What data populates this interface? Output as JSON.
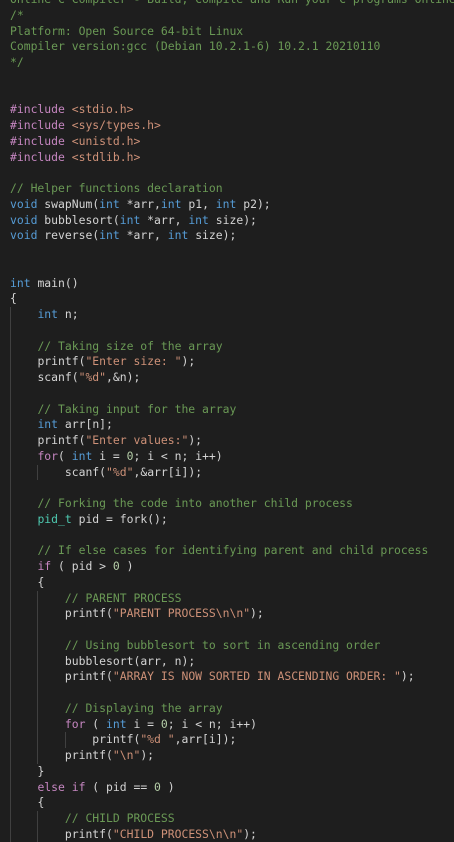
{
  "editor": {
    "background": "#1e1e1e",
    "colors": {
      "comment": "#6a9955",
      "keyword": "#c586c0",
      "string": "#ce9178",
      "type": "#569cd6",
      "variable": "#9cdcfe",
      "function": "#dcdcaa",
      "number": "#b5cea8",
      "type_name": "#4ec9b0",
      "plain": "#d4d4d4"
    },
    "lines": [
      {
        "indent": 0,
        "tokens": [
          {
            "t": "comment",
            "v": "Online C Compiler - Build, Compile and Run your C programs Online in your favorite browser"
          }
        ]
      },
      {
        "indent": 0,
        "tokens": [
          {
            "t": "comment",
            "v": "/*"
          }
        ]
      },
      {
        "indent": 0,
        "tokens": [
          {
            "t": "comment",
            "v": "Platform: Open Source 64-bit Linux"
          }
        ]
      },
      {
        "indent": 0,
        "tokens": [
          {
            "t": "comment",
            "v": "Compiler version:gcc (Debian 10.2.1-6) 10.2.1 20210110"
          }
        ]
      },
      {
        "indent": 0,
        "tokens": [
          {
            "t": "comment",
            "v": "*/"
          }
        ]
      },
      {
        "indent": 0,
        "tokens": []
      },
      {
        "indent": 0,
        "tokens": []
      },
      {
        "indent": 0,
        "tokens": [
          {
            "t": "keyword",
            "v": "#include"
          },
          {
            "t": "plain",
            "v": " "
          },
          {
            "t": "string",
            "v": "<stdio.h>"
          }
        ]
      },
      {
        "indent": 0,
        "tokens": [
          {
            "t": "keyword",
            "v": "#include"
          },
          {
            "t": "plain",
            "v": " "
          },
          {
            "t": "string",
            "v": "<sys/types.h>"
          }
        ]
      },
      {
        "indent": 0,
        "tokens": [
          {
            "t": "keyword",
            "v": "#include"
          },
          {
            "t": "plain",
            "v": " "
          },
          {
            "t": "string",
            "v": "<unistd.h>"
          }
        ]
      },
      {
        "indent": 0,
        "tokens": [
          {
            "t": "keyword",
            "v": "#include"
          },
          {
            "t": "plain",
            "v": " "
          },
          {
            "t": "string",
            "v": "<stdlib.h>"
          }
        ]
      },
      {
        "indent": 0,
        "tokens": []
      },
      {
        "indent": 0,
        "tokens": [
          {
            "t": "comment",
            "v": "// Helper functions declaration"
          }
        ]
      },
      {
        "indent": 0,
        "tokens": [
          {
            "t": "type",
            "v": "void"
          },
          {
            "t": "plain",
            "v": " "
          },
          {
            "t": "function",
            "v": "swapNum"
          },
          {
            "t": "plain",
            "v": "("
          },
          {
            "t": "type",
            "v": "int"
          },
          {
            "t": "plain",
            "v": " *"
          },
          {
            "t": "variable",
            "v": "arr"
          },
          {
            "t": "plain",
            "v": ","
          },
          {
            "t": "type",
            "v": "int"
          },
          {
            "t": "plain",
            "v": " "
          },
          {
            "t": "variable",
            "v": "p1"
          },
          {
            "t": "plain",
            "v": ", "
          },
          {
            "t": "type",
            "v": "int"
          },
          {
            "t": "plain",
            "v": " "
          },
          {
            "t": "variable",
            "v": "p2"
          },
          {
            "t": "plain",
            "v": ");"
          }
        ]
      },
      {
        "indent": 0,
        "tokens": [
          {
            "t": "type",
            "v": "void"
          },
          {
            "t": "plain",
            "v": " "
          },
          {
            "t": "function",
            "v": "bubblesort"
          },
          {
            "t": "plain",
            "v": "("
          },
          {
            "t": "type",
            "v": "int"
          },
          {
            "t": "plain",
            "v": " *"
          },
          {
            "t": "variable",
            "v": "arr"
          },
          {
            "t": "plain",
            "v": ", "
          },
          {
            "t": "type",
            "v": "int"
          },
          {
            "t": "plain",
            "v": " "
          },
          {
            "t": "variable",
            "v": "size"
          },
          {
            "t": "plain",
            "v": ");"
          }
        ]
      },
      {
        "indent": 0,
        "tokens": [
          {
            "t": "type",
            "v": "void"
          },
          {
            "t": "plain",
            "v": " "
          },
          {
            "t": "function",
            "v": "reverse"
          },
          {
            "t": "plain",
            "v": "("
          },
          {
            "t": "type",
            "v": "int"
          },
          {
            "t": "plain",
            "v": " *"
          },
          {
            "t": "variable",
            "v": "arr"
          },
          {
            "t": "plain",
            "v": ", "
          },
          {
            "t": "type",
            "v": "int"
          },
          {
            "t": "plain",
            "v": " "
          },
          {
            "t": "variable",
            "v": "size"
          },
          {
            "t": "plain",
            "v": ");"
          }
        ]
      },
      {
        "indent": 0,
        "tokens": []
      },
      {
        "indent": 0,
        "tokens": []
      },
      {
        "indent": 0,
        "tokens": [
          {
            "t": "type",
            "v": "int"
          },
          {
            "t": "plain",
            "v": " "
          },
          {
            "t": "function",
            "v": "main"
          },
          {
            "t": "plain",
            "v": "()"
          }
        ]
      },
      {
        "indent": 0,
        "tokens": [
          {
            "t": "plain",
            "v": "{"
          }
        ]
      },
      {
        "indent": 1,
        "tokens": [
          {
            "t": "type",
            "v": "int"
          },
          {
            "t": "plain",
            "v": " "
          },
          {
            "t": "variable",
            "v": "n"
          },
          {
            "t": "plain",
            "v": ";"
          }
        ]
      },
      {
        "indent": 1,
        "tokens": []
      },
      {
        "indent": 1,
        "tokens": [
          {
            "t": "comment",
            "v": "// Taking size of the array"
          }
        ]
      },
      {
        "indent": 1,
        "tokens": [
          {
            "t": "function",
            "v": "printf"
          },
          {
            "t": "plain",
            "v": "("
          },
          {
            "t": "string",
            "v": "\"Enter size: \""
          },
          {
            "t": "plain",
            "v": ");"
          }
        ]
      },
      {
        "indent": 1,
        "tokens": [
          {
            "t": "function",
            "v": "scanf"
          },
          {
            "t": "plain",
            "v": "("
          },
          {
            "t": "string",
            "v": "\"%d\""
          },
          {
            "t": "plain",
            "v": ",&"
          },
          {
            "t": "variable",
            "v": "n"
          },
          {
            "t": "plain",
            "v": ");"
          }
        ]
      },
      {
        "indent": 1,
        "tokens": []
      },
      {
        "indent": 1,
        "tokens": [
          {
            "t": "comment",
            "v": "// Taking input for the array"
          }
        ]
      },
      {
        "indent": 1,
        "tokens": [
          {
            "t": "type",
            "v": "int"
          },
          {
            "t": "plain",
            "v": " "
          },
          {
            "t": "variable",
            "v": "arr"
          },
          {
            "t": "plain",
            "v": "["
          },
          {
            "t": "variable",
            "v": "n"
          },
          {
            "t": "plain",
            "v": "];"
          }
        ]
      },
      {
        "indent": 1,
        "tokens": [
          {
            "t": "function",
            "v": "printf"
          },
          {
            "t": "plain",
            "v": "("
          },
          {
            "t": "string",
            "v": "\"Enter values:\""
          },
          {
            "t": "plain",
            "v": ");"
          }
        ]
      },
      {
        "indent": 1,
        "tokens": [
          {
            "t": "keyword",
            "v": "for"
          },
          {
            "t": "plain",
            "v": "( "
          },
          {
            "t": "type",
            "v": "int"
          },
          {
            "t": "plain",
            "v": " "
          },
          {
            "t": "variable",
            "v": "i"
          },
          {
            "t": "plain",
            "v": " = "
          },
          {
            "t": "num",
            "v": "0"
          },
          {
            "t": "plain",
            "v": "; "
          },
          {
            "t": "variable",
            "v": "i"
          },
          {
            "t": "plain",
            "v": " < "
          },
          {
            "t": "variable",
            "v": "n"
          },
          {
            "t": "plain",
            "v": "; "
          },
          {
            "t": "variable",
            "v": "i"
          },
          {
            "t": "plain",
            "v": "++)"
          }
        ]
      },
      {
        "indent": 2,
        "tokens": [
          {
            "t": "function",
            "v": "scanf"
          },
          {
            "t": "plain",
            "v": "("
          },
          {
            "t": "string",
            "v": "\"%d\""
          },
          {
            "t": "plain",
            "v": ",&"
          },
          {
            "t": "variable",
            "v": "arr"
          },
          {
            "t": "plain",
            "v": "["
          },
          {
            "t": "variable",
            "v": "i"
          },
          {
            "t": "plain",
            "v": "]);"
          }
        ]
      },
      {
        "indent": 1,
        "tokens": []
      },
      {
        "indent": 1,
        "tokens": [
          {
            "t": "comment",
            "v": "// Forking the code into another child process"
          }
        ]
      },
      {
        "indent": 1,
        "tokens": [
          {
            "t": "type2",
            "v": "pid_t"
          },
          {
            "t": "plain",
            "v": " "
          },
          {
            "t": "variable",
            "v": "pid"
          },
          {
            "t": "plain",
            "v": " = "
          },
          {
            "t": "function",
            "v": "fork"
          },
          {
            "t": "plain",
            "v": "();"
          }
        ]
      },
      {
        "indent": 1,
        "tokens": []
      },
      {
        "indent": 1,
        "tokens": [
          {
            "t": "comment",
            "v": "// If else cases for identifying parent and child process"
          }
        ]
      },
      {
        "indent": 1,
        "tokens": [
          {
            "t": "keyword",
            "v": "if"
          },
          {
            "t": "plain",
            "v": " ( "
          },
          {
            "t": "variable",
            "v": "pid"
          },
          {
            "t": "plain",
            "v": " > "
          },
          {
            "t": "num",
            "v": "0"
          },
          {
            "t": "plain",
            "v": " )"
          }
        ]
      },
      {
        "indent": 1,
        "tokens": [
          {
            "t": "plain",
            "v": "{"
          }
        ]
      },
      {
        "indent": 2,
        "tokens": [
          {
            "t": "comment",
            "v": "// PARENT PROCESS"
          }
        ]
      },
      {
        "indent": 2,
        "tokens": [
          {
            "t": "function",
            "v": "printf"
          },
          {
            "t": "plain",
            "v": "("
          },
          {
            "t": "string",
            "v": "\"PARENT PROCESS\\n\\n\""
          },
          {
            "t": "plain",
            "v": ");"
          }
        ]
      },
      {
        "indent": 2,
        "tokens": []
      },
      {
        "indent": 2,
        "tokens": [
          {
            "t": "comment",
            "v": "// Using bubblesort to sort in ascending order"
          }
        ]
      },
      {
        "indent": 2,
        "tokens": [
          {
            "t": "function",
            "v": "bubblesort"
          },
          {
            "t": "plain",
            "v": "("
          },
          {
            "t": "variable",
            "v": "arr"
          },
          {
            "t": "plain",
            "v": ", "
          },
          {
            "t": "variable",
            "v": "n"
          },
          {
            "t": "plain",
            "v": ");"
          }
        ]
      },
      {
        "indent": 2,
        "tokens": [
          {
            "t": "function",
            "v": "printf"
          },
          {
            "t": "plain",
            "v": "("
          },
          {
            "t": "string",
            "v": "\"ARRAY IS NOW SORTED IN ASCENDING ORDER: \""
          },
          {
            "t": "plain",
            "v": ");"
          }
        ]
      },
      {
        "indent": 2,
        "tokens": []
      },
      {
        "indent": 2,
        "tokens": [
          {
            "t": "comment",
            "v": "// Displaying the array"
          }
        ]
      },
      {
        "indent": 2,
        "tokens": [
          {
            "t": "keyword",
            "v": "for"
          },
          {
            "t": "plain",
            "v": " ( "
          },
          {
            "t": "type",
            "v": "int"
          },
          {
            "t": "plain",
            "v": " "
          },
          {
            "t": "variable",
            "v": "i"
          },
          {
            "t": "plain",
            "v": " = "
          },
          {
            "t": "num",
            "v": "0"
          },
          {
            "t": "plain",
            "v": "; "
          },
          {
            "t": "variable",
            "v": "i"
          },
          {
            "t": "plain",
            "v": " < "
          },
          {
            "t": "variable",
            "v": "n"
          },
          {
            "t": "plain",
            "v": "; "
          },
          {
            "t": "variable",
            "v": "i"
          },
          {
            "t": "plain",
            "v": "++)"
          }
        ]
      },
      {
        "indent": 3,
        "tokens": [
          {
            "t": "function",
            "v": "printf"
          },
          {
            "t": "plain",
            "v": "("
          },
          {
            "t": "string",
            "v": "\"%d \""
          },
          {
            "t": "plain",
            "v": ","
          },
          {
            "t": "variable",
            "v": "arr"
          },
          {
            "t": "plain",
            "v": "["
          },
          {
            "t": "variable",
            "v": "i"
          },
          {
            "t": "plain",
            "v": "]);"
          }
        ]
      },
      {
        "indent": 2,
        "tokens": [
          {
            "t": "function",
            "v": "printf"
          },
          {
            "t": "plain",
            "v": "("
          },
          {
            "t": "string",
            "v": "\"\\n\""
          },
          {
            "t": "plain",
            "v": ");"
          }
        ]
      },
      {
        "indent": 1,
        "tokens": [
          {
            "t": "plain",
            "v": "}"
          }
        ]
      },
      {
        "indent": 1,
        "tokens": [
          {
            "t": "keyword",
            "v": "else"
          },
          {
            "t": "plain",
            "v": " "
          },
          {
            "t": "keyword",
            "v": "if"
          },
          {
            "t": "plain",
            "v": " ( "
          },
          {
            "t": "variable",
            "v": "pid"
          },
          {
            "t": "plain",
            "v": " == "
          },
          {
            "t": "num",
            "v": "0"
          },
          {
            "t": "plain",
            "v": " )"
          }
        ]
      },
      {
        "indent": 1,
        "tokens": [
          {
            "t": "plain",
            "v": "{"
          }
        ]
      },
      {
        "indent": 2,
        "tokens": [
          {
            "t": "comment",
            "v": "// CHILD PROCESS"
          }
        ]
      },
      {
        "indent": 2,
        "tokens": [
          {
            "t": "function",
            "v": "printf"
          },
          {
            "t": "plain",
            "v": "("
          },
          {
            "t": "string",
            "v": "\"CHILD PROCESS\\n\\n\""
          },
          {
            "t": "plain",
            "v": ");"
          }
        ]
      }
    ]
  }
}
